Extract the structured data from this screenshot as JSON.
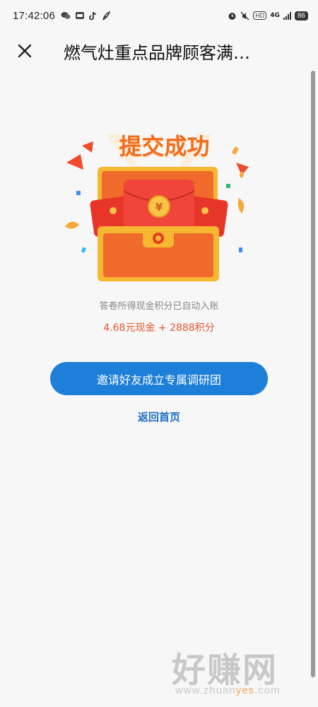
{
  "status_bar": {
    "time": "17:42:06",
    "network": "4G",
    "hd": "HD",
    "battery": "86"
  },
  "nav": {
    "title": "燃气灶重点品牌顾客满…"
  },
  "result": {
    "title": "提交成功",
    "description": "答卷所得现金积分已自动入账",
    "reward": "4.68元现金 + 2888积分"
  },
  "actions": {
    "invite_label": "邀请好友成立专属调研团",
    "home_label": "返回首页"
  },
  "watermark": {
    "title": "好赚网",
    "url_prefix": "www.zhuan",
    "url_accent": "yes",
    "url_suffix": ".com"
  },
  "colors": {
    "accent_orange": "#f26b1d",
    "reward_red": "#e4572e",
    "button_blue": "#1e7fd8",
    "link_blue": "#1e6fc2"
  }
}
